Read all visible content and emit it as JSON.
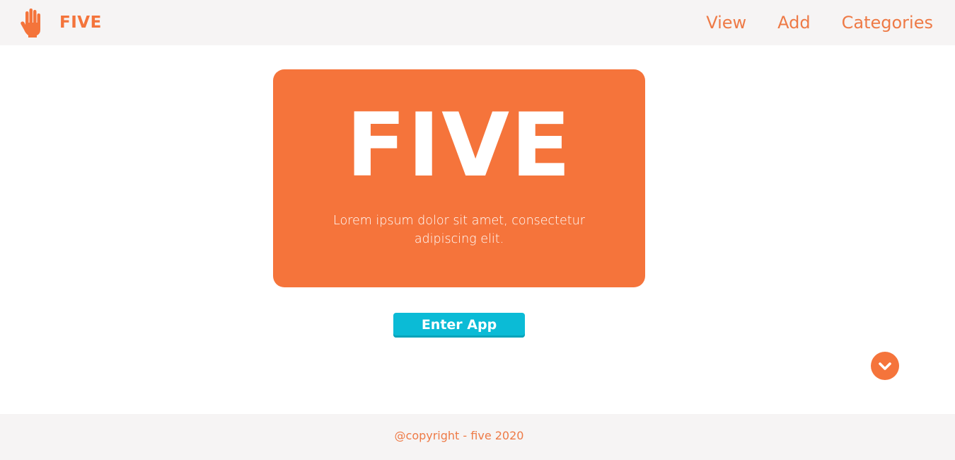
{
  "navbar": {
    "brand_icon": "hand-icon",
    "brand_name": "FIVE",
    "links": [
      {
        "label": "View"
      },
      {
        "label": "Add"
      },
      {
        "label": "Categories"
      }
    ]
  },
  "hero": {
    "title": "FIVE",
    "subtitle": "Lorem ipsum dolor sit amet, consectetur adipiscing elit."
  },
  "cta": {
    "label": "Enter App"
  },
  "scroll_button": {
    "icon": "chevron-down-icon"
  },
  "footer": {
    "text": "@copyright - five 2020"
  },
  "colors": {
    "accent": "#f5743b",
    "button": "#0bbbd6",
    "bar_background": "#f6f4f4"
  }
}
